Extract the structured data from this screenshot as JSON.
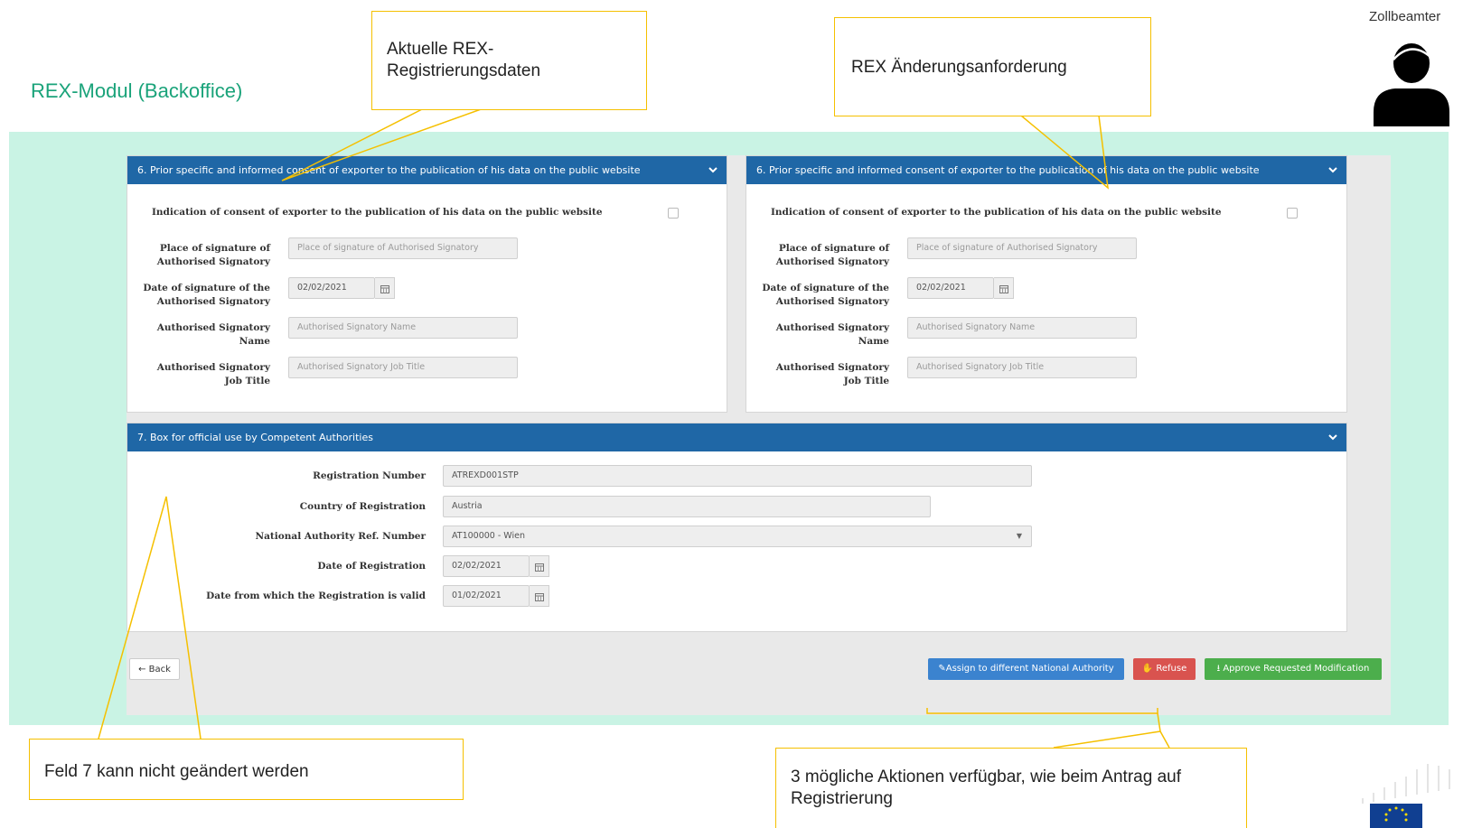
{
  "slide": {
    "title": "REX-Modul (Backoffice)",
    "role": "Zollbeamter"
  },
  "left_panel": {
    "header": "6. Prior specific and informed consent of exporter to the publication of his data on the public website",
    "consent_label": "Indication of consent of exporter to the publication of his data on the public website",
    "consent_checked": false,
    "place_label": "Place of signature of Authorised Signatory",
    "place_placeholder": "Place of signature of Authorised Signatory",
    "date_label": "Date of signature of the Authorised Signatory",
    "date_value": "02/02/2021",
    "name_label": "Authorised Signatory Name",
    "name_placeholder": "Authorised Signatory Name",
    "job_label": "Authorised Signatory Job Title",
    "job_placeholder": "Authorised Signatory Job Title"
  },
  "right_panel": {
    "header": "6. Prior specific and informed consent of exporter to the publication of his data on the public website",
    "consent_label": "Indication of consent of exporter to the publication of his data on the public website",
    "consent_checked": false,
    "place_label": "Place of signature of Authorised Signatory",
    "place_placeholder": "Place of signature of Authorised Signatory",
    "date_label": "Date of signature of the Authorised Signatory",
    "date_value": "02/02/2021",
    "name_label": "Authorised Signatory Name",
    "name_placeholder": "Authorised Signatory Name",
    "job_label": "Authorised Signatory Job Title",
    "job_placeholder": "Authorised Signatory Job Title"
  },
  "box7": {
    "header": "7. Box for official use by Competent Authorities",
    "reg_number_label": "Registration Number",
    "reg_number_value": "ATREXD001STP",
    "country_label": "Country of Registration",
    "country_value": "Austria",
    "authority_label": "National Authority Ref. Number",
    "authority_value": "AT100000 - Wien",
    "reg_date_label": "Date of Registration",
    "reg_date_value": "02/02/2021",
    "valid_from_label": "Date from which the Registration is valid",
    "valid_from_value": "01/02/2021"
  },
  "actions": {
    "back": "Back",
    "assign": "Assign to different National Authority",
    "refuse": "Refuse",
    "approve": "Approve Requested Modification"
  },
  "callouts": {
    "current_data": "Aktuelle REX-Registrierungsdaten",
    "change_request": "REX Änderungsanforderung",
    "field7": "Feld 7 kann nicht geändert werden",
    "actions": "3 mögliche Aktionen verfügbar, wie beim Antrag auf Registrierung"
  },
  "colors": {
    "panel_header": "#1f67a6",
    "mint_background": "#c9f3e4",
    "title_green": "#1aa37a",
    "callout_border": "#f5c000",
    "btn_blue": "#3b83cf",
    "btn_red": "#d9534f",
    "btn_green": "#4cae4c"
  },
  "icons": [
    "chevron-down-icon",
    "calendar-icon",
    "arrow-left-icon",
    "pencil-icon",
    "thumbs-down-icon",
    "download-icon",
    "person-icon",
    "eu-flag-icon"
  ]
}
